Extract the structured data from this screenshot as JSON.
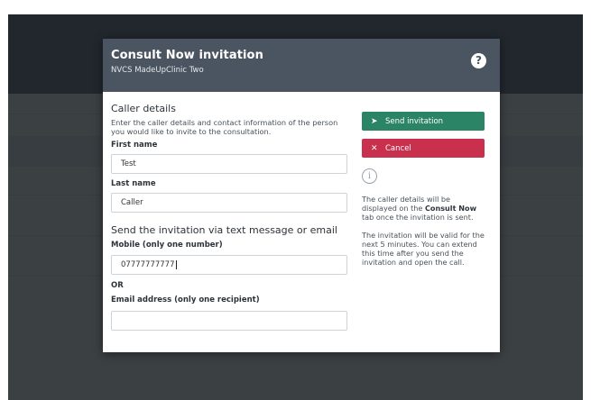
{
  "modal": {
    "title": "Consult Now invitation",
    "subtitle": "NVCS MadeUpClinic Two",
    "help_icon": "?"
  },
  "caller": {
    "title": "Caller details",
    "description": "Enter the caller details and contact information of the person you would like to invite to the consultation.",
    "first_name_label": "First name",
    "first_name_value": "Test",
    "last_name_label": "Last name",
    "last_name_value": "Caller"
  },
  "send": {
    "title": "Send the invitation via text message or email",
    "mobile_label": "Mobile (only one number)",
    "mobile_value": "07777777777",
    "or_label": "OR",
    "email_label": "Email address (only one recipient)",
    "email_value": ""
  },
  "actions": {
    "send_label": "Send invitation",
    "cancel_label": "Cancel"
  },
  "info": {
    "text1_before": "The caller details will be displayed on the ",
    "text1_bold": "Consult Now",
    "text1_after": " tab once the invitation is sent.",
    "text2": "The invitation will be valid for the next 5 minutes. You can extend this time after you send the invitation and open the call."
  },
  "icons": {
    "help": "question-icon",
    "send": "paper-plane-icon",
    "cancel": "close-icon",
    "info": "info-icon"
  },
  "colors": {
    "header": "#4b5561",
    "send_button": "#2b8466",
    "cancel_button": "#c8304e"
  }
}
